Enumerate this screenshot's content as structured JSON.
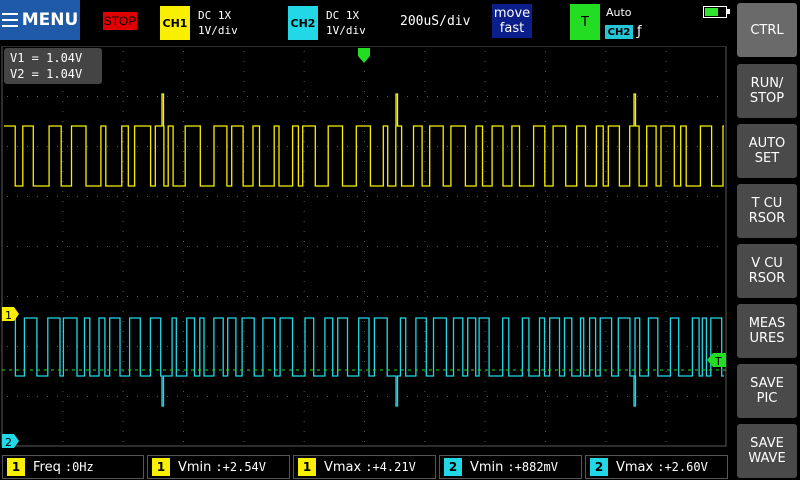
{
  "topbar": {
    "menu_label": "MENU",
    "run_state": "STOP",
    "ch1": {
      "tag": "CH1",
      "coupling": "DC  1X",
      "scale": "1V/div",
      "color": "#f8f000"
    },
    "ch2": {
      "tag": "CH2",
      "coupling": "DC  1X",
      "scale": "1V/div",
      "color": "#22d8e6"
    },
    "timebase": "200uS/div",
    "move_mode": {
      "line1": "move",
      "line2": "fast"
    },
    "trigger": {
      "label": "T",
      "mode": "Auto",
      "source": "CH2",
      "edge": "ƒ"
    }
  },
  "cursors": {
    "v1": "V1 = 1.04V",
    "v2": "V2 = 1.04V"
  },
  "markers": {
    "ch1": "1",
    "ch2": "2",
    "trigger_level": "T"
  },
  "side_buttons": [
    {
      "label": "CTRL"
    },
    {
      "label": "RUN/\nSTOP"
    },
    {
      "label": "AUTO\nSET"
    },
    {
      "label": "T CU\nRSOR"
    },
    {
      "label": "V CU\nRSOR"
    },
    {
      "label": "MEAS\nURES"
    },
    {
      "label": "SAVE\nPIC"
    },
    {
      "label": "SAVE\nWAVE"
    }
  ],
  "measurements": [
    {
      "ch": "1",
      "label": "Freq",
      "value": "0Hz"
    },
    {
      "ch": "1",
      "label": "Vmin",
      "value": "+2.54V"
    },
    {
      "ch": "1",
      "label": "Vmax",
      "value": "+4.21V"
    },
    {
      "ch": "2",
      "label": "Vmin",
      "value": "+882mV"
    },
    {
      "ch": "2",
      "label": "Vmax",
      "value": "+2.60V"
    }
  ],
  "colors": {
    "ch1": "#f8f000",
    "ch2": "#22d8e6",
    "trigger": "#22dd22",
    "grid": "#5a5a5a"
  }
}
